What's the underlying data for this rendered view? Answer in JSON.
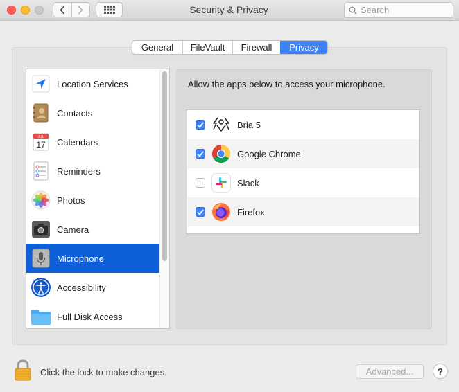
{
  "window": {
    "title": "Security & Privacy"
  },
  "search": {
    "placeholder": "Search"
  },
  "tabs": [
    {
      "label": "General"
    },
    {
      "label": "FileVault"
    },
    {
      "label": "Firewall"
    },
    {
      "label": "Privacy",
      "active": true
    }
  ],
  "sidebar": {
    "items": [
      {
        "label": "Location Services",
        "icon": "location-arrow-icon"
      },
      {
        "label": "Contacts",
        "icon": "contacts-book-icon"
      },
      {
        "label": "Calendars",
        "icon": "calendar-icon",
        "icon_month": "JUL",
        "icon_day": "17"
      },
      {
        "label": "Reminders",
        "icon": "reminders-list-icon"
      },
      {
        "label": "Photos",
        "icon": "photos-flower-icon"
      },
      {
        "label": "Camera",
        "icon": "camera-icon"
      },
      {
        "label": "Microphone",
        "icon": "microphone-icon",
        "selected": true
      },
      {
        "label": "Accessibility",
        "icon": "accessibility-icon"
      },
      {
        "label": "Full Disk Access",
        "icon": "folder-icon"
      }
    ]
  },
  "content": {
    "heading": "Allow the apps below to access your microphone.",
    "apps": [
      {
        "name": "Bria 5",
        "checked": true,
        "icon": "bria-icon"
      },
      {
        "name": "Google Chrome",
        "checked": true,
        "icon": "chrome-icon"
      },
      {
        "name": "Slack",
        "checked": false,
        "icon": "slack-icon"
      },
      {
        "name": "Firefox",
        "checked": true,
        "icon": "firefox-icon"
      }
    ]
  },
  "footer": {
    "lock_text": "Click the lock to make changes.",
    "advanced_label": "Advanced...",
    "help_label": "?"
  },
  "colors": {
    "accent": "#3e82f7",
    "selection": "#0e5fd8"
  }
}
